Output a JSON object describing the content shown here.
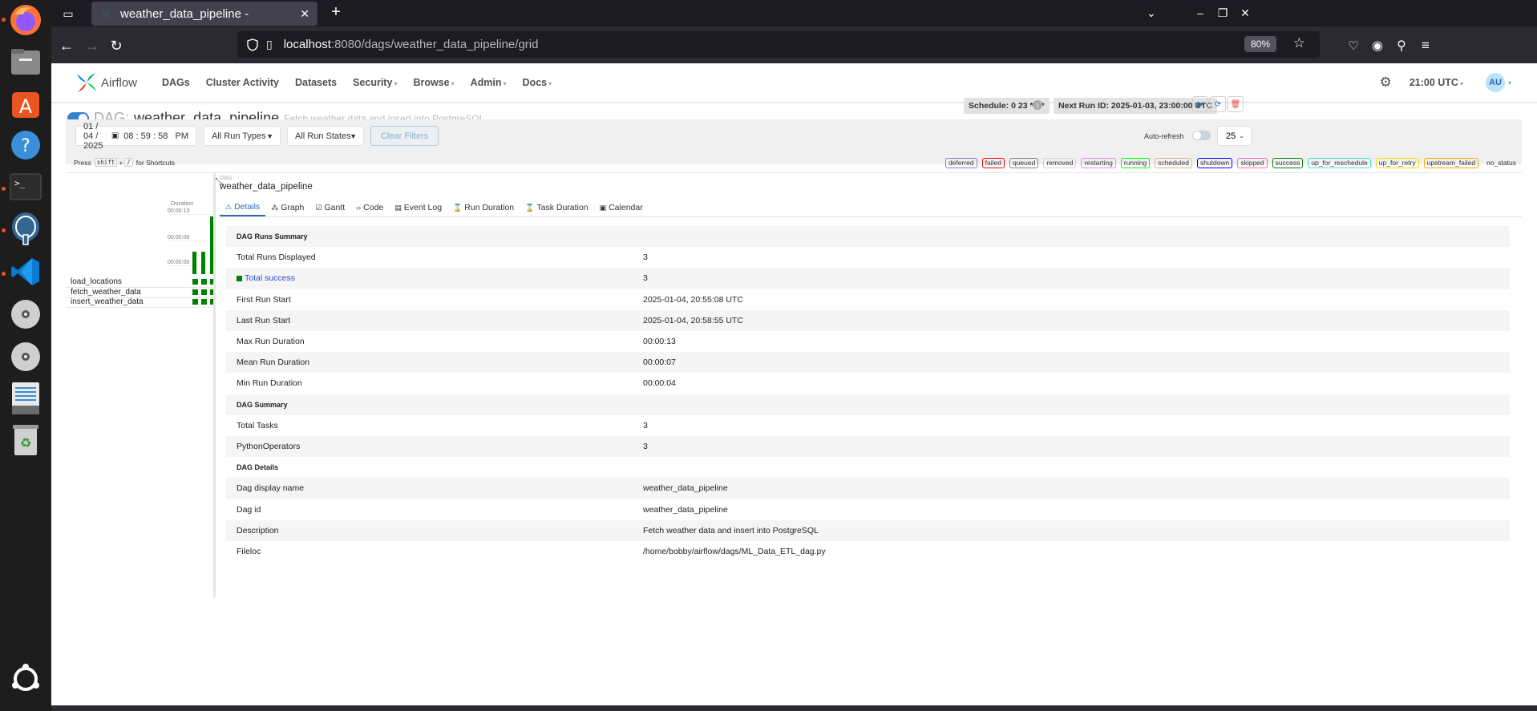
{
  "browser": {
    "tab_title": "weather_data_pipeline -",
    "url_host": "localhost",
    "url_path": ":8080/dags/weather_data_pipeline/grid",
    "zoom": "80%"
  },
  "header": {
    "logo_text": "Airflow",
    "menu": [
      {
        "label": "DAGs",
        "has_caret": false
      },
      {
        "label": "Cluster Activity",
        "has_caret": false
      },
      {
        "label": "Datasets",
        "has_caret": false
      },
      {
        "label": "Security",
        "has_caret": true
      },
      {
        "label": "Browse",
        "has_caret": true
      },
      {
        "label": "Admin",
        "has_caret": true
      },
      {
        "label": "Docs",
        "has_caret": true
      }
    ],
    "time": "21:00 UTC",
    "avatar": "AU"
  },
  "dag": {
    "prefix": "DAG:",
    "name": "weather_data_pipeline",
    "description": "Fetch weather data and insert into PostgreSQL",
    "schedule": "Schedule: 0 23 * * *",
    "next_run": "Next Run ID: 2025-01-03, 23:00:00 UTC"
  },
  "filters": {
    "date": "01 / 04 / 2025",
    "time": "08 : 59 : 58   PM",
    "run_types": "All Run Types",
    "run_states": "All Run States",
    "clear": "Clear Filters",
    "auto_refresh": "Auto-refresh",
    "count": "25"
  },
  "shortcuts": {
    "press": "Press",
    "key1": "shift",
    "plus": "+",
    "key2": "/",
    "suffix": "for Shortcuts"
  },
  "legend": [
    {
      "label": "deferred",
      "color": "#9370db"
    },
    {
      "label": "failed",
      "color": "#ff0000"
    },
    {
      "label": "queued",
      "color": "#808080"
    },
    {
      "label": "removed",
      "color": "#d3d3d3"
    },
    {
      "label": "restarting",
      "color": "#ee82ee"
    },
    {
      "label": "running",
      "color": "#00ff00"
    },
    {
      "label": "scheduled",
      "color": "#d2b48c"
    },
    {
      "label": "shutdown",
      "color": "#0000ff"
    },
    {
      "label": "skipped",
      "color": "#ff69b4"
    },
    {
      "label": "success",
      "color": "#008000"
    },
    {
      "label": "up_for_reschedule",
      "color": "#40e0d0"
    },
    {
      "label": "up_for_retry",
      "color": "#ffd700"
    },
    {
      "label": "upstream_failed",
      "color": "#ffa500"
    },
    {
      "label": "no_status",
      "color": "#ffffff"
    }
  ],
  "grid": {
    "duration_label": "Duration",
    "ticks": [
      "00:00:13",
      "00:00:06",
      "00:00:00"
    ],
    "run_durations_seconds": [
      4,
      4,
      13
    ],
    "tasks": [
      "load_locations",
      "fetch_weather_data",
      "insert_weather_data"
    ]
  },
  "details": {
    "crumb_small": "DAG",
    "crumb_big": "weather_data_pipeline",
    "tabs": [
      "Details",
      "Graph",
      "Gantt",
      "Code",
      "Event Log",
      "Run Duration",
      "Task Duration",
      "Calendar"
    ],
    "rows": [
      {
        "type": "section",
        "k": "DAG Runs Summary",
        "v": ""
      },
      {
        "type": "row",
        "k": "Total Runs Displayed",
        "v": "3"
      },
      {
        "type": "success",
        "k": "Total success",
        "v": "3"
      },
      {
        "type": "row",
        "k": "First Run Start",
        "v": "2025-01-04, 20:55:08 UTC"
      },
      {
        "type": "row",
        "k": "Last Run Start",
        "v": "2025-01-04, 20:58:55 UTC"
      },
      {
        "type": "row",
        "k": "Max Run Duration",
        "v": "00:00:13"
      },
      {
        "type": "row",
        "k": "Mean Run Duration",
        "v": "00:00:07"
      },
      {
        "type": "row",
        "k": "Min Run Duration",
        "v": "00:00:04"
      },
      {
        "type": "section",
        "k": "DAG Summary",
        "v": ""
      },
      {
        "type": "row",
        "k": "Total Tasks",
        "v": "3"
      },
      {
        "type": "row",
        "k": "PythonOperators",
        "v": "3"
      },
      {
        "type": "section",
        "k": "DAG Details",
        "v": ""
      },
      {
        "type": "row",
        "k": "Dag display name",
        "v": "weather_data_pipeline"
      },
      {
        "type": "row",
        "k": "Dag id",
        "v": "weather_data_pipeline"
      },
      {
        "type": "row",
        "k": "Description",
        "v": "Fetch weather data and insert into PostgreSQL"
      },
      {
        "type": "row",
        "k": "Fileloc",
        "v": "/home/bobby/airflow/dags/ML_Data_ETL_dag.py"
      }
    ]
  }
}
